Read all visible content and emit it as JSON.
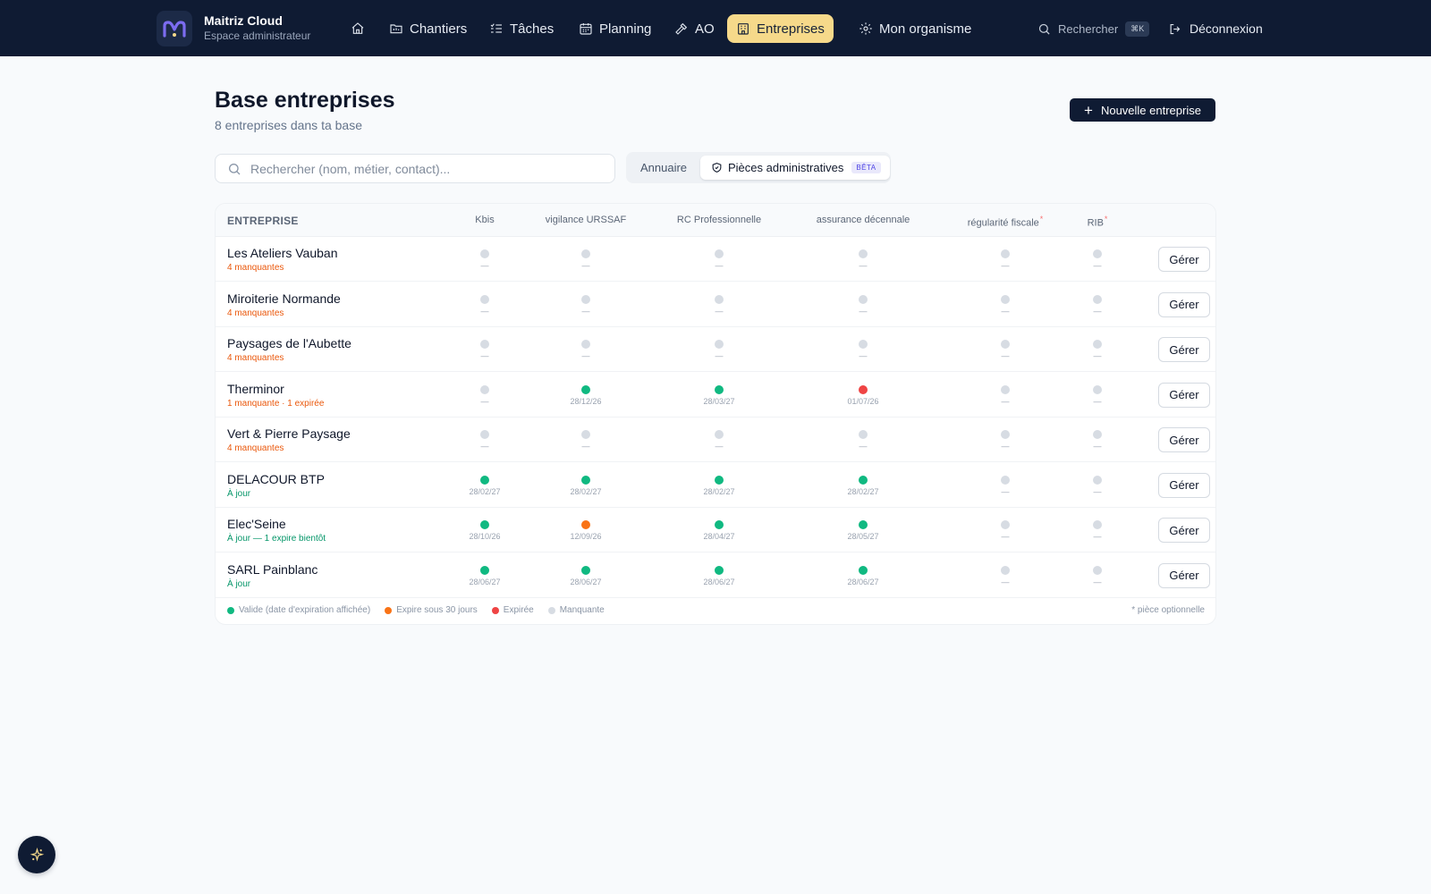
{
  "app": {
    "name": "Maitriz Cloud",
    "subtitle": "Espace administrateur"
  },
  "nav": {
    "items": [
      {
        "id": "home",
        "label": "",
        "icon": "home-icon"
      },
      {
        "id": "chantiers",
        "label": "Chantiers",
        "icon": "folder-icon"
      },
      {
        "id": "taches",
        "label": "Tâches",
        "icon": "checklist-icon"
      },
      {
        "id": "planning",
        "label": "Planning",
        "icon": "calendar-icon"
      },
      {
        "id": "ao",
        "label": "AO",
        "icon": "hammer-icon"
      },
      {
        "id": "entreprises",
        "label": "Entreprises",
        "icon": "building-icon",
        "active": true
      },
      {
        "id": "organisme",
        "label": "Mon organisme",
        "icon": "gear-icon"
      }
    ],
    "search_label": "Rechercher",
    "search_shortcut": "⌘K",
    "logout_label": "Déconnexion"
  },
  "header": {
    "title": "Base entreprises",
    "subtitle": "8 entreprises dans ta base",
    "new_button": "Nouvelle entreprise"
  },
  "search": {
    "placeholder": "Rechercher (nom, métier, contact)..."
  },
  "tabs": {
    "annuaire": "Annuaire",
    "pieces": "Pièces administratives",
    "beta": "BÊTA"
  },
  "table": {
    "first_header": "ENTREPRISE",
    "columns": [
      {
        "label": "Kbis",
        "optional": false
      },
      {
        "label": "vigilance URSSAF",
        "optional": false
      },
      {
        "label": "RC Professionnelle",
        "optional": false
      },
      {
        "label": "assurance décennale",
        "optional": false
      },
      {
        "label": "régularité fiscale",
        "optional": true
      },
      {
        "label": "RIB",
        "optional": true
      }
    ],
    "optional_marker": "*",
    "manage_label": "Gérer",
    "missing_placeholder": "—",
    "rows": [
      {
        "name": "Les Ateliers Vauban",
        "status": "4 manquantes",
        "tone": "warn",
        "cells": [
          {
            "s": "missing",
            "d": ""
          },
          {
            "s": "missing",
            "d": ""
          },
          {
            "s": "missing",
            "d": ""
          },
          {
            "s": "missing",
            "d": ""
          },
          {
            "s": "missing",
            "d": ""
          },
          {
            "s": "missing",
            "d": ""
          }
        ]
      },
      {
        "name": "Miroiterie Normande",
        "status": "4 manquantes",
        "tone": "warn",
        "cells": [
          {
            "s": "missing",
            "d": ""
          },
          {
            "s": "missing",
            "d": ""
          },
          {
            "s": "missing",
            "d": ""
          },
          {
            "s": "missing",
            "d": ""
          },
          {
            "s": "missing",
            "d": ""
          },
          {
            "s": "missing",
            "d": ""
          }
        ]
      },
      {
        "name": "Paysages de l'Aubette",
        "status": "4 manquantes",
        "tone": "warn",
        "cells": [
          {
            "s": "missing",
            "d": ""
          },
          {
            "s": "missing",
            "d": ""
          },
          {
            "s": "missing",
            "d": ""
          },
          {
            "s": "missing",
            "d": ""
          },
          {
            "s": "missing",
            "d": ""
          },
          {
            "s": "missing",
            "d": ""
          }
        ]
      },
      {
        "name": "Therminor",
        "status": "1 manquante · 1 expirée",
        "tone": "warn",
        "cells": [
          {
            "s": "missing",
            "d": ""
          },
          {
            "s": "valid",
            "d": "28/12/26"
          },
          {
            "s": "valid",
            "d": "28/03/27"
          },
          {
            "s": "expired",
            "d": "01/07/26"
          },
          {
            "s": "missing",
            "d": ""
          },
          {
            "s": "missing",
            "d": ""
          }
        ]
      },
      {
        "name": "Vert & Pierre Paysage",
        "status": "4 manquantes",
        "tone": "warn",
        "cells": [
          {
            "s": "missing",
            "d": ""
          },
          {
            "s": "missing",
            "d": ""
          },
          {
            "s": "missing",
            "d": ""
          },
          {
            "s": "missing",
            "d": ""
          },
          {
            "s": "missing",
            "d": ""
          },
          {
            "s": "missing",
            "d": ""
          }
        ]
      },
      {
        "name": "DELACOUR BTP",
        "status": "À jour",
        "tone": "ok",
        "cells": [
          {
            "s": "valid",
            "d": "28/02/27"
          },
          {
            "s": "valid",
            "d": "28/02/27"
          },
          {
            "s": "valid",
            "d": "28/02/27"
          },
          {
            "s": "valid",
            "d": "28/02/27"
          },
          {
            "s": "missing",
            "d": ""
          },
          {
            "s": "missing",
            "d": ""
          }
        ]
      },
      {
        "name": "Elec'Seine",
        "status": "À jour — 1 expire bientôt",
        "tone": "ok",
        "cells": [
          {
            "s": "valid",
            "d": "28/10/26"
          },
          {
            "s": "expiring",
            "d": "12/09/26"
          },
          {
            "s": "valid",
            "d": "28/04/27"
          },
          {
            "s": "valid",
            "d": "28/05/27"
          },
          {
            "s": "missing",
            "d": ""
          },
          {
            "s": "missing",
            "d": ""
          }
        ]
      },
      {
        "name": "SARL Painblanc",
        "status": "À jour",
        "tone": "ok",
        "cells": [
          {
            "s": "valid",
            "d": "28/06/27"
          },
          {
            "s": "valid",
            "d": "28/06/27"
          },
          {
            "s": "valid",
            "d": "28/06/27"
          },
          {
            "s": "valid",
            "d": "28/06/27"
          },
          {
            "s": "missing",
            "d": ""
          },
          {
            "s": "missing",
            "d": ""
          }
        ]
      }
    ]
  },
  "legend": {
    "items": [
      {
        "label": "Valide (date d'expiration affichée)",
        "color": "#10b981"
      },
      {
        "label": "Expire sous 30 jours",
        "color": "#f97316"
      },
      {
        "label": "Expirée",
        "color": "#ef4444"
      },
      {
        "label": "Manquante",
        "color": "#d7dce3"
      }
    ],
    "footnote": "* pièce optionnelle"
  },
  "colors": {
    "topbar": "#0f1b33",
    "accent": "#f6d98a",
    "valid": "#10b981",
    "expiring": "#f97316",
    "expired": "#ef4444",
    "missing": "#d7dce3"
  }
}
